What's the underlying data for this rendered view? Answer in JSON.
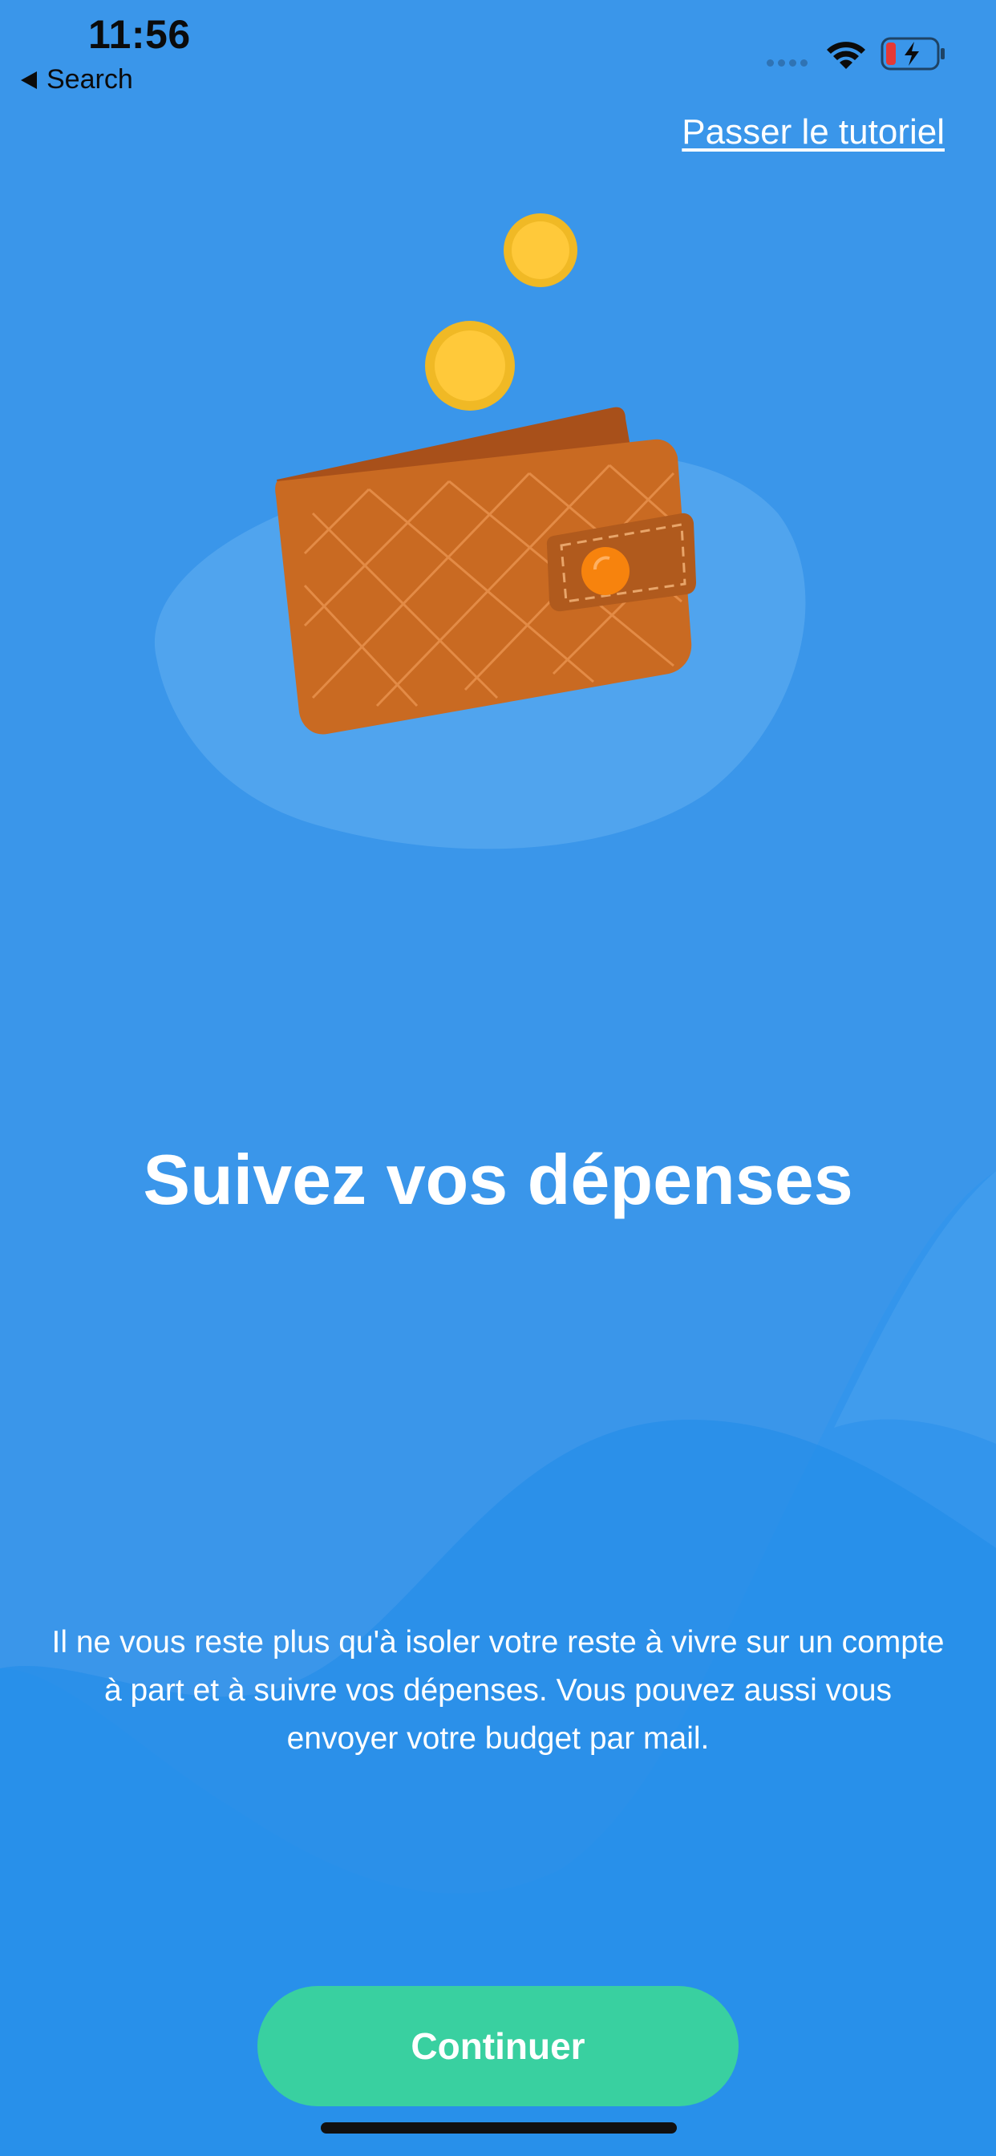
{
  "status_bar": {
    "time": "11:56",
    "back_label": "Search",
    "icons": [
      "signal-dots-icon",
      "wifi-icon",
      "battery-charging-icon"
    ]
  },
  "header": {
    "skip_label": "Passer le tutoriel"
  },
  "illustration": {
    "icon": "wallet-with-coins-icon",
    "colors": {
      "wallet": "#c96a22",
      "coin": "#f6c131",
      "blob": "#5aa9f0",
      "button_clasp": "#f7830d"
    }
  },
  "content": {
    "title": "Suivez vos dépenses",
    "description": "Il ne vous reste plus qu'à isoler votre reste à vivre sur un compte à part et à suivre vos dépenses. Vous pouvez aussi vous envoyer votre budget par mail."
  },
  "footer": {
    "continue_label": "Continuer"
  },
  "colors": {
    "background": "#3a96ea",
    "accent": "#39d0a0",
    "text": "#ffffff"
  }
}
